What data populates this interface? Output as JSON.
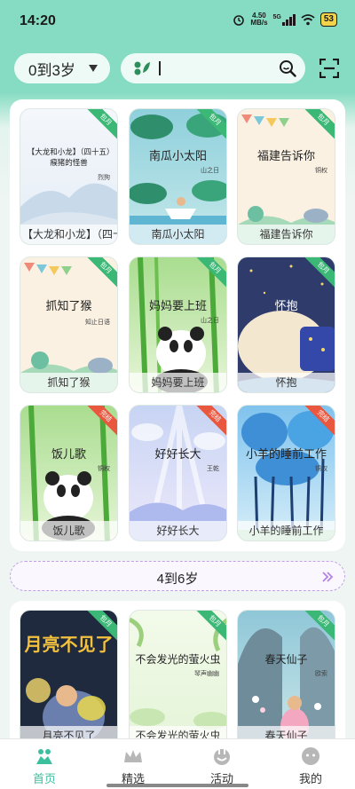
{
  "status": {
    "time": "14:20",
    "net_speed_top": "4.50",
    "net_speed_bottom": "MB/s",
    "signal": "5G",
    "battery": "53"
  },
  "header": {
    "age_selected": "0到3岁"
  },
  "section1": {
    "cards": [
      {
        "caption": "【大龙和小龙】（四十…",
        "cover_title": "【大龙和小龙】（四十五）瘊猪的怪兽",
        "cover_author": "烈狗",
        "ribbon": "包月",
        "ribbon_color": "green"
      },
      {
        "caption": "南瓜小太阳",
        "cover_title": "南瓜小太阳",
        "cover_author": "山之日",
        "ribbon": "包月",
        "ribbon_color": "green"
      },
      {
        "caption": "福建告诉你",
        "cover_title": "福建告诉你",
        "cover_author": "铜权",
        "ribbon": "包月",
        "ribbon_color": "green"
      },
      {
        "caption": "抓知了猴",
        "cover_title": "抓知了猴",
        "cover_author": "知止日语",
        "ribbon": "包月",
        "ribbon_color": "green"
      },
      {
        "caption": "妈妈要上班",
        "cover_title": "妈妈要上班",
        "cover_author": "山之日",
        "ribbon": "包月",
        "ribbon_color": "green"
      },
      {
        "caption": "怀抱",
        "cover_title": "怀抱",
        "cover_author": "",
        "ribbon": "包月",
        "ribbon_color": "green"
      },
      {
        "caption": "饭儿歌",
        "cover_title": "饭儿歌",
        "cover_author": "铜权",
        "ribbon": "完结",
        "ribbon_color": "red"
      },
      {
        "caption": "好好长大",
        "cover_title": "好好长大",
        "cover_author": "王乾",
        "ribbon": "完结",
        "ribbon_color": "red"
      },
      {
        "caption": "小羊的睡前工作",
        "cover_title": "小羊的睡前工作",
        "cover_author": "铜权",
        "ribbon": "完结",
        "ribbon_color": "red"
      }
    ]
  },
  "separator": {
    "label": "4到6岁"
  },
  "section2": {
    "cards": [
      {
        "caption": "月亮不见了",
        "cover_title": "月亮不见了",
        "cover_author": "",
        "ribbon": "包月",
        "ribbon_color": "green"
      },
      {
        "caption": "不会发光的萤火虫",
        "cover_title": "不会发光的萤火虫",
        "cover_author": "琴声幽幽",
        "ribbon": "包月",
        "ribbon_color": "green"
      },
      {
        "caption": "春天仙子",
        "cover_title": "春天仙子",
        "cover_author": "欧索",
        "ribbon": "包月",
        "ribbon_color": "green"
      }
    ]
  },
  "tabbar": {
    "items": [
      {
        "label": "首页",
        "icon": "home-icon",
        "active": true
      },
      {
        "label": "精选",
        "icon": "crown-icon",
        "active": false
      },
      {
        "label": "活动",
        "icon": "activity-icon",
        "active": false
      },
      {
        "label": "我的",
        "icon": "profile-icon",
        "active": false
      }
    ]
  },
  "colors": {
    "accent": "#86dcc2",
    "tab_active": "#3bbf9d",
    "ribbon_green": "#3cb876",
    "ribbon_red": "#e9573f"
  }
}
